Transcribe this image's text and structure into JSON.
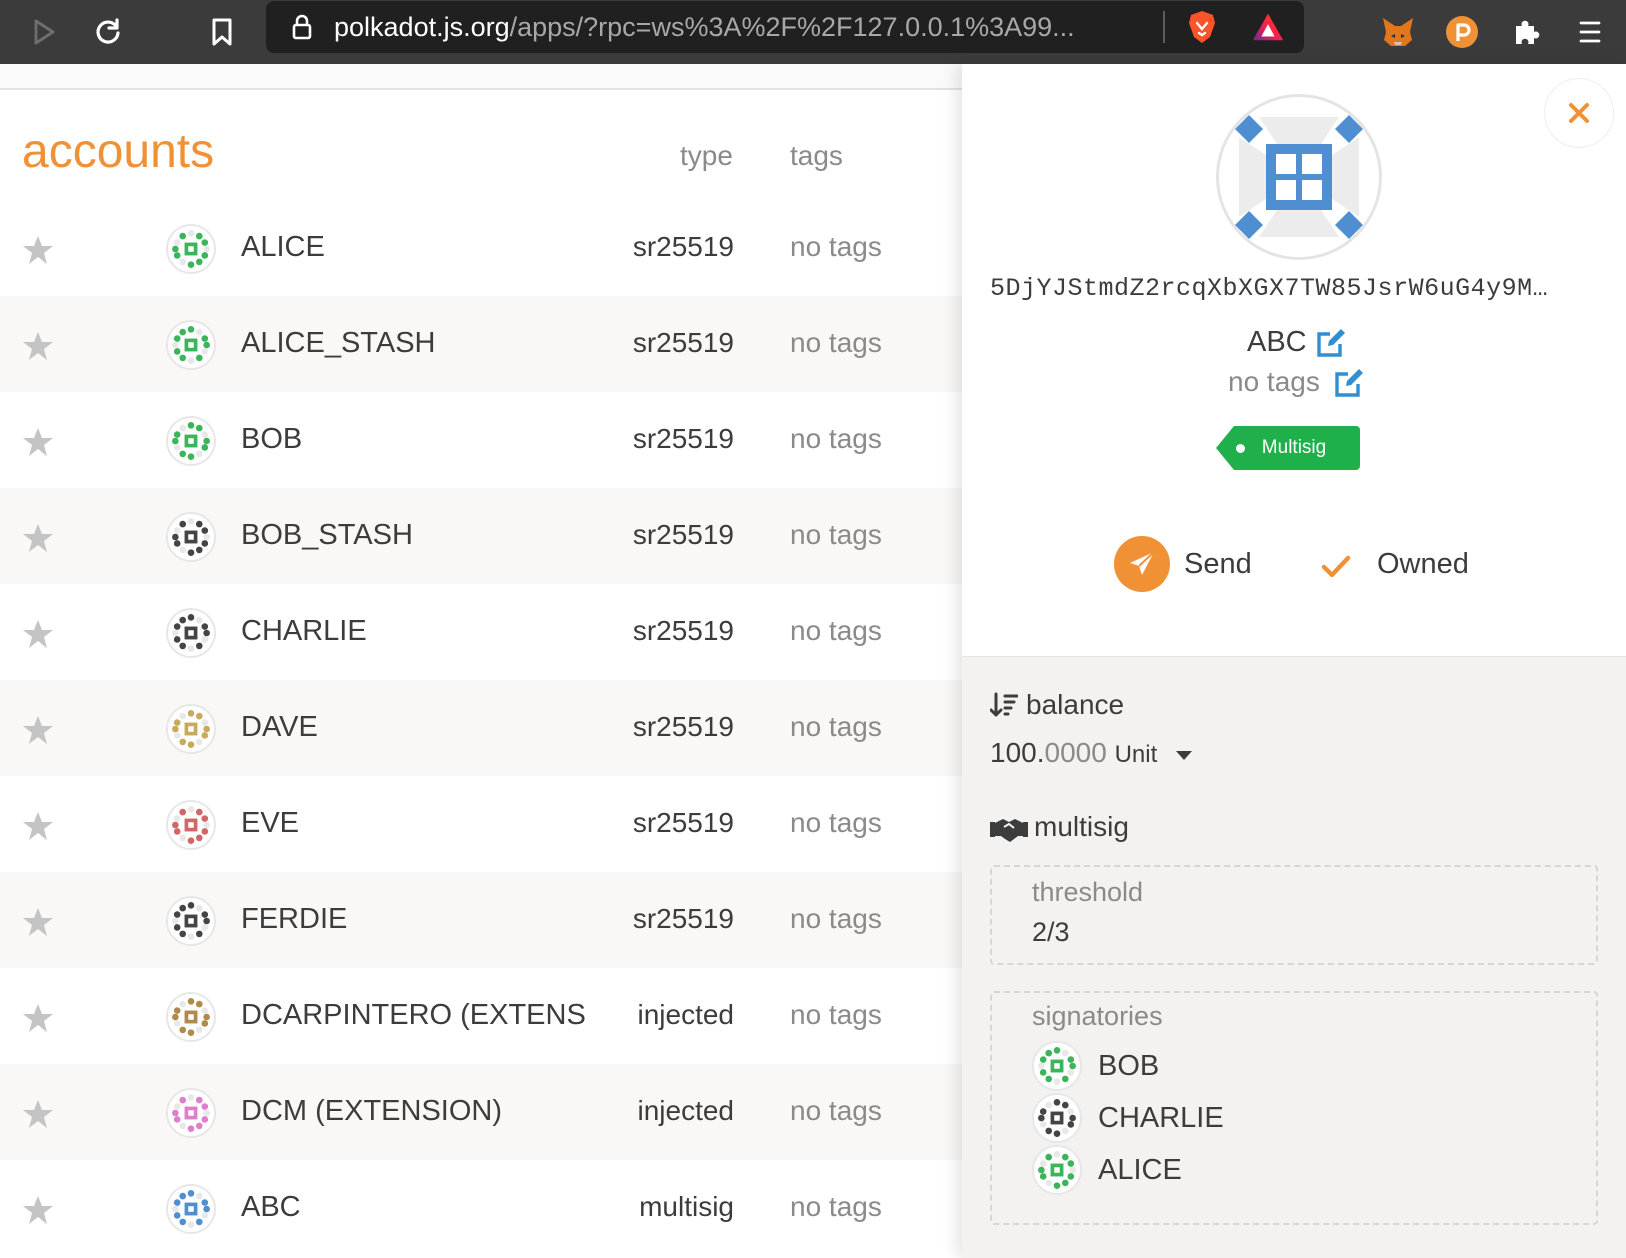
{
  "browser": {
    "url_host": "polkadot.js.org",
    "url_path": "/apps/?rpc=ws%3A%2F%2F127.0.0.1%3A99..."
  },
  "accounts": {
    "heading": "accounts",
    "columns": {
      "type": "type",
      "tags": "tags"
    },
    "rows": [
      {
        "name": "ALICE",
        "type": "sr25519",
        "tags": "no tags",
        "icon": "alice-identicon",
        "color": "#3bb55a"
      },
      {
        "name": "ALICE_STASH",
        "type": "sr25519",
        "tags": "no tags",
        "icon": "alice-stash-identicon",
        "color": "#3bb55a"
      },
      {
        "name": "BOB",
        "type": "sr25519",
        "tags": "no tags",
        "icon": "bob-identicon",
        "color": "#3bb55a"
      },
      {
        "name": "BOB_STASH",
        "type": "sr25519",
        "tags": "no tags",
        "icon": "bob-stash-identicon",
        "color": "#444444"
      },
      {
        "name": "CHARLIE",
        "type": "sr25519",
        "tags": "no tags",
        "icon": "charlie-identicon",
        "color": "#444444"
      },
      {
        "name": "DAVE",
        "type": "sr25519",
        "tags": "no tags",
        "icon": "dave-identicon",
        "color": "#c9a95b"
      },
      {
        "name": "EVE",
        "type": "sr25519",
        "tags": "no tags",
        "icon": "eve-identicon",
        "color": "#d26565"
      },
      {
        "name": "FERDIE",
        "type": "sr25519",
        "tags": "no tags",
        "icon": "ferdie-identicon",
        "color": "#444444"
      },
      {
        "name": "DCARPINTERO (EXTENS",
        "type": "injected",
        "tags": "no tags",
        "icon": "dcarpintero-identicon",
        "color": "#b08a4a"
      },
      {
        "name": "DCM (EXTENSION)",
        "type": "injected",
        "tags": "no tags",
        "icon": "dcm-identicon",
        "color": "#e07fc9"
      },
      {
        "name": "ABC",
        "type": "multisig",
        "tags": "no tags",
        "icon": "abc-identicon",
        "color": "#4f8fd1"
      }
    ]
  },
  "sidebar": {
    "address": "5DjYJStmdZ2rcqXbXGX7TW85JsrW6uG4y9M…",
    "name": "ABC",
    "tags": "no tags",
    "badge": "Multisig",
    "send_label": "Send",
    "owned_label": "Owned",
    "balance": {
      "title": "balance",
      "whole": "100.",
      "decimals": "0000",
      "unit": "Unit"
    },
    "multisig": {
      "title": "multisig",
      "threshold_label": "threshold",
      "threshold_value": "2/3",
      "signatories_label": "signatories",
      "signatories": [
        {
          "name": "BOB",
          "icon": "bob-identicon",
          "color": "#3bb55a"
        },
        {
          "name": "CHARLIE",
          "icon": "charlie-identicon",
          "color": "#444444"
        },
        {
          "name": "ALICE",
          "icon": "alice-identicon",
          "color": "#3bb55a"
        }
      ]
    }
  },
  "colors": {
    "accent": "#f19135",
    "badge_green": "#20b04b",
    "edit_blue": "#2f8fd1"
  }
}
